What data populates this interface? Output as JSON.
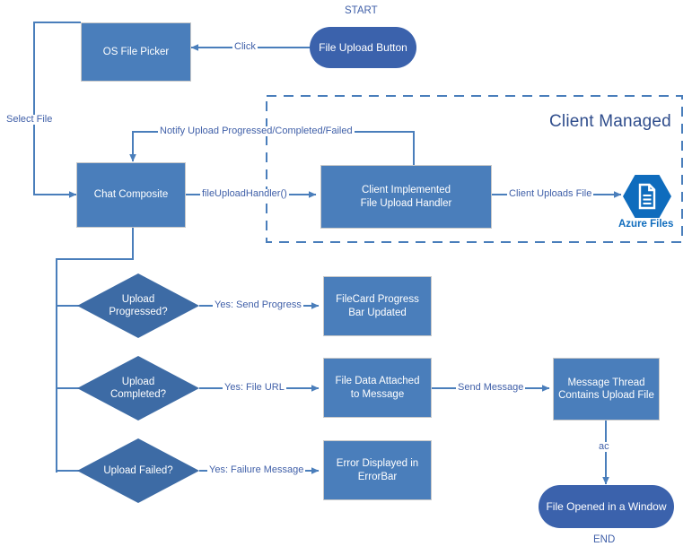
{
  "diagram": {
    "title_start": "START",
    "title_end": "END",
    "group_label": "Client Managed",
    "azure_label": "Azure Files",
    "azure_icon": "azure-files-hexagon-document-icon",
    "colors": {
      "rect_fill": "#4a7ebb",
      "diamond_fill": "#3d6ba5",
      "terminator_fill": "#3b62ac",
      "connector": "#4a7ebb",
      "label_text": "#3f5fa8",
      "group_text": "#2f4d8c",
      "azure_text": "#0f6cbd",
      "background": "#ffffff"
    }
  },
  "nodes": {
    "file_upload_button": "File Upload Button",
    "os_file_picker": "OS File Picker",
    "chat_composite": "Chat Composite",
    "client_handler_line1": "Client Implemented",
    "client_handler_line2": "File Upload Handler",
    "upload_progressed_line1": "Upload",
    "upload_progressed_line2": "Progressed?",
    "upload_completed_line1": "Upload",
    "upload_completed_line2": "Completed?",
    "upload_failed": "Upload Failed?",
    "filecard_line1": "FileCard Progress",
    "filecard_line2": "Bar Updated",
    "file_data_line1": "File Data Attached",
    "file_data_line2": "to Message",
    "error_line1": "Error Displayed in",
    "error_line2": "ErrorBar",
    "message_thread_line1": "Message Thread",
    "message_thread_line2": "Contains Upload File",
    "file_opened": "File Opened in a Window"
  },
  "edges": {
    "click": "Click",
    "select_file": "Select File",
    "notify": "Notify Upload Progressed/Completed/Failed",
    "file_upload_handler": "fileUploadHandler()",
    "client_uploads_file": "Client Uploads File",
    "yes_send_progress": "Yes: Send Progress",
    "yes_file_url": "Yes: File URL",
    "yes_failure_message": "Yes: Failure Message",
    "send_message": "Send Message",
    "ac": "ac"
  }
}
